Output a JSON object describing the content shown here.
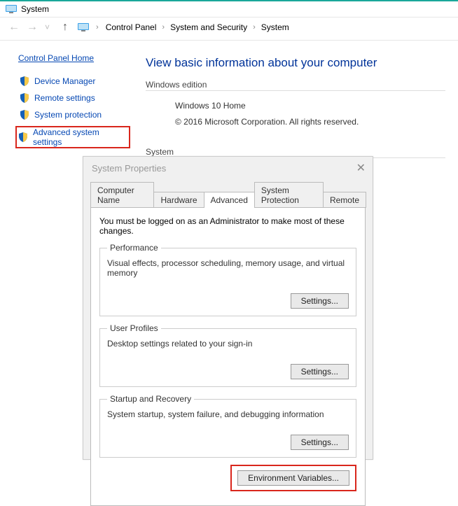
{
  "window": {
    "title": "System"
  },
  "breadcrumb": {
    "items": [
      "Control Panel",
      "System and Security",
      "System"
    ]
  },
  "sidebar": {
    "home": "Control Panel Home",
    "items": [
      {
        "label": "Device Manager"
      },
      {
        "label": "Remote settings"
      },
      {
        "label": "System protection"
      },
      {
        "label": "Advanced system settings",
        "highlighted": true
      }
    ]
  },
  "main": {
    "heading": "View basic information about your computer",
    "edition_label": "Windows edition",
    "edition_name": "Windows 10 Home",
    "edition_copyright": "© 2016 Microsoft Corporation. All rights reserved.",
    "system_label": "System"
  },
  "dialog": {
    "title": "System Properties",
    "tabs": [
      "Computer Name",
      "Hardware",
      "Advanced",
      "System Protection",
      "Remote"
    ],
    "active_tab": "Advanced",
    "intro": "You must be logged on as an Administrator to make most of these changes.",
    "groups": {
      "performance": {
        "legend": "Performance",
        "desc": "Visual effects, processor scheduling, memory usage, and virtual memory",
        "button": "Settings..."
      },
      "profiles": {
        "legend": "User Profiles",
        "desc": "Desktop settings related to your sign-in",
        "button": "Settings..."
      },
      "startup": {
        "legend": "Startup and Recovery",
        "desc": "System startup, system failure, and debugging information",
        "button": "Settings..."
      }
    },
    "env_button": "Environment Variables..."
  }
}
